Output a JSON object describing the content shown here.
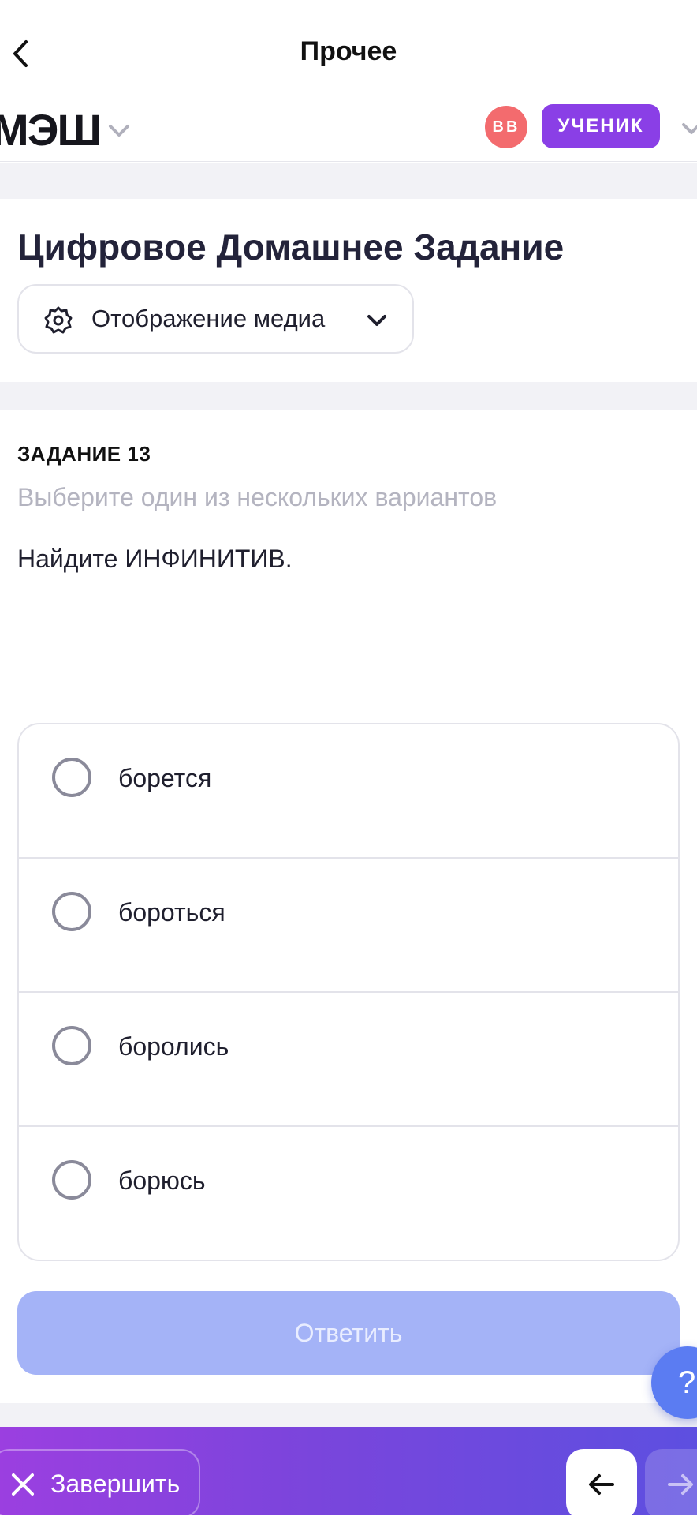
{
  "nav": {
    "title": "Прочее"
  },
  "header": {
    "logo": "МЭШ",
    "avatar_initials": "ВВ",
    "role": "УЧЕНИК"
  },
  "page": {
    "title": "Цифровое Домашнее Задание",
    "media_button": "Отображение медиа"
  },
  "task": {
    "number": "ЗАДАНИЕ 13",
    "hint": "Выберите один из нескольких вариантов",
    "question": "Найдите ИНФИНИТИВ.",
    "options": [
      "борется",
      "бороться",
      "боролись",
      "борюсь"
    ],
    "submit": "Ответить"
  },
  "help": {
    "label": "?"
  },
  "bottom": {
    "finish": "Завершить"
  },
  "colors": {
    "accent": "#8a3fe6",
    "avatar": "#f36b6e",
    "submit_disabled": "#a4b3f7",
    "help": "#5b7cf2"
  }
}
